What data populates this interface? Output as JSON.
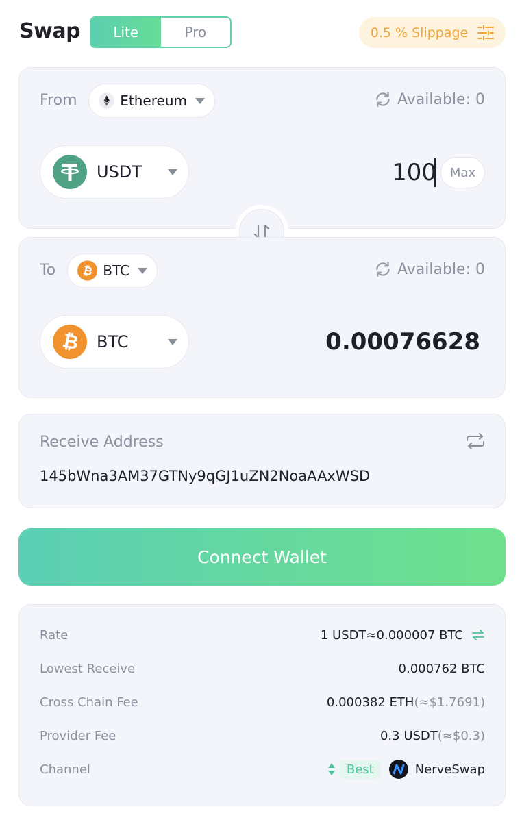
{
  "header": {
    "title": "Swap",
    "tabs": [
      {
        "label": "Lite"
      },
      {
        "label": "Pro"
      }
    ],
    "slippage_label": "0.5 % Slippage"
  },
  "from": {
    "label": "From",
    "chain": "Ethereum",
    "available": "Available: 0",
    "token": "USDT",
    "amount": "100",
    "max_label": "Max"
  },
  "to": {
    "label": "To",
    "chain": "BTC",
    "available": "Available: 0",
    "token": "BTC",
    "amount": "0.00076628"
  },
  "receive": {
    "label": "Receive Address",
    "address": "145bWna3AM37GTNy9qGJ1uZN2NoaAAxWSD"
  },
  "connect_label": "Connect Wallet",
  "info": {
    "rate": {
      "label": "Rate",
      "value": "1 USDT≈0.000007 BTC"
    },
    "lowest": {
      "label": "Lowest Receive",
      "value": "0.000762 BTC"
    },
    "cross": {
      "label": "Cross Chain Fee",
      "value": "0.000382 ETH",
      "sub": "(≈$1.7691)"
    },
    "provider": {
      "label": "Provider Fee",
      "value": "0.3 USDT",
      "sub": "(≈$0.3)"
    },
    "channel": {
      "label": "Channel",
      "badge": "Best",
      "name": "NerveSwap"
    }
  },
  "colors": {
    "accent": "#5fd3a6",
    "slippage_bg": "#fdf3de",
    "slippage_text": "#eda73c",
    "usdt": "#4fa283",
    "btc": "#f0922e"
  },
  "icons": {
    "chain_from": "ethereum-icon",
    "chain_to": "bitcoin-icon",
    "refresh": "refresh-icon",
    "swap": "swap-direction-icon",
    "address": "address-swap-icon",
    "rate": "rate-toggle-icon",
    "channel": "sort-icon"
  }
}
